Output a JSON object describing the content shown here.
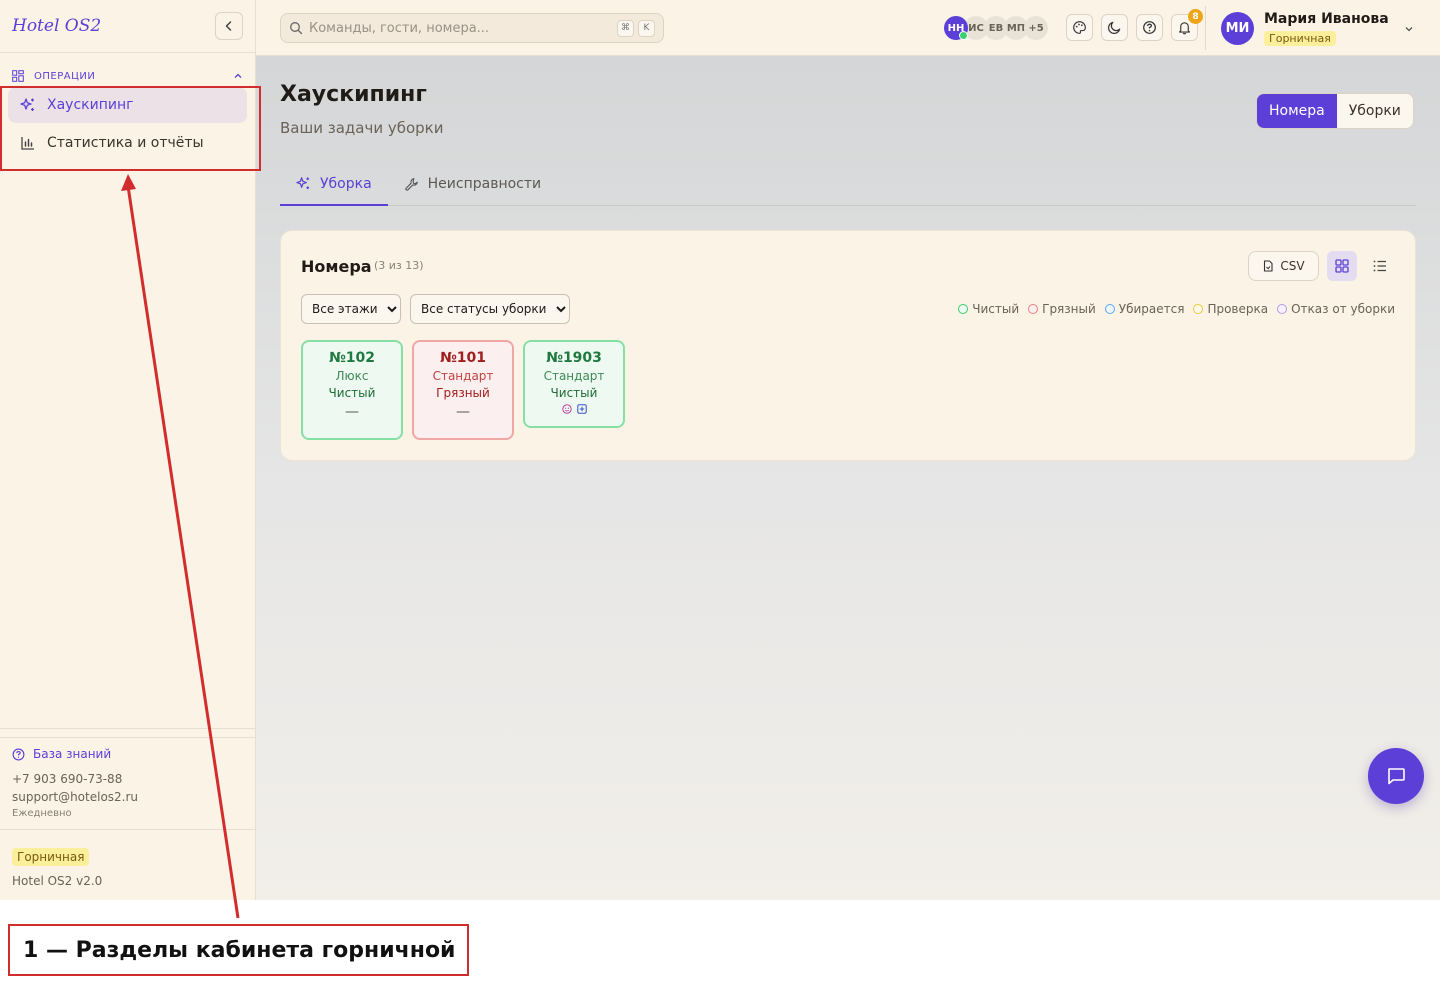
{
  "sidebar": {
    "brand": "Hotel OS2",
    "section": "ОПЕРАЦИИ",
    "items": [
      {
        "label": "Хаускипинг",
        "active": true
      },
      {
        "label": "Статистика и отчёты",
        "active": false
      }
    ],
    "footer": {
      "kb": "База знаний",
      "phone": "+7 903 690-73-88",
      "email": "support@hotelos2.ru",
      "schedule": "Ежедневно",
      "role": "Горничная",
      "version": "Hotel OS2 v2.0"
    }
  },
  "topbar": {
    "search_placeholder": "Команды, гости, номера...",
    "kbd": [
      "⌘",
      "K"
    ],
    "presence": [
      "НН",
      "ИС",
      "ЕВ",
      "МП",
      "+5"
    ],
    "notif_count": "8",
    "user": {
      "initials": "МИ",
      "name": "Мария Иванова",
      "role": "Горничная"
    }
  },
  "page": {
    "title": "Хаускипинг",
    "subtitle": "Ваши задачи уборки",
    "segments": [
      "Номера",
      "Уборки"
    ],
    "tabs": [
      "Уборка",
      "Неисправности"
    ]
  },
  "card": {
    "title": "Номера",
    "count": "(3 из 13)",
    "csv": "CSV",
    "filters": [
      "Все этажи",
      "Все статусы уборки"
    ],
    "legend": [
      {
        "label": "Чистый",
        "color": "#3ccf6e"
      },
      {
        "label": "Грязный",
        "color": "#ef7d7d"
      },
      {
        "label": "Убирается",
        "color": "#5aa8ee"
      },
      {
        "label": "Проверка",
        "color": "#e8c93a"
      },
      {
        "label": "Отказ от уборки",
        "color": "#b49ae8"
      }
    ],
    "rooms": [
      {
        "number": "№102",
        "type": "Люкс",
        "status": "Чистый",
        "mark": "—"
      },
      {
        "number": "№101",
        "type": "Стандарт",
        "status": "Грязный",
        "mark": "—"
      },
      {
        "number": "№1903",
        "type": "Стандарт",
        "status": "Чистый",
        "mark": ""
      }
    ]
  },
  "annotation": {
    "caption": "1 — Разделы кабинета горничной",
    "color": "#d22d2d"
  },
  "colors": {
    "accent": "#5b3fd6",
    "sidebar_bg": "#fbf3e6"
  }
}
